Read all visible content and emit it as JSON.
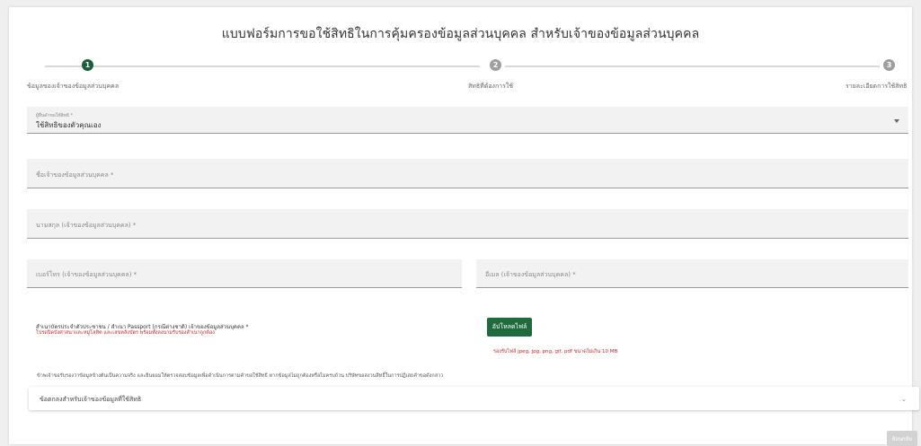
{
  "form": {
    "title": "แบบฟอร์มการขอใช้สิทธิในการคุ้มครองข้อมูลส่วนบุคคล สำหรับเจ้าของข้อมูลส่วนบุคคล"
  },
  "stepper": {
    "steps": [
      {
        "number": "1",
        "label": "ข้อมูลของเจ้าของข้อมูลส่วนบุคคล"
      },
      {
        "number": "2",
        "label": "สิทธิที่ต้องการใช้"
      },
      {
        "number": "3",
        "label": "รายละเอียดการใช้สิทธิ"
      }
    ]
  },
  "fields": {
    "requester_type": {
      "label": "ผู้ยื่นคำขอใช้สิทธิ *",
      "value": "ใช้สิทธิของตัวคุณเอง"
    },
    "full_name": {
      "label": "ชื่อเจ้าของข้อมูลส่วนบุคคล *"
    },
    "last_name": {
      "label": "นามสกุล (เจ้าของข้อมูลส่วนบุคคล) *"
    },
    "phone": {
      "label": "เบอร์โทร (เจ้าของข้อมูลส่วนบุคคล) *"
    },
    "email": {
      "label": "อีเมล (เจ้าของข้อมูลส่วนบุคคล) *"
    }
  },
  "upload": {
    "label": "สำเนาบัตรประจำตัวประชาชน / สำเนา Passport (กรณีต่างชาติ) เจ้าของข้อมูลส่วนบุคคล *",
    "hint": "โปรดปิดบังศาสนาและหมู่โลหิต และเลขหลังบัตร พร้อมทั้งลงนามรับรองสำเนาถูกต้อง",
    "button": "อัปโหลดไฟล์",
    "file_hint": "รองรับไฟล์ jpeg, jpg, png, gif, pdf ขนาดไม่เกิน 10 MB"
  },
  "consent_text": "ข้าพเจ้าขอรับรองว่าข้อมูลข้างต้นเป็นความจริง และยินยอมให้ตรวจสอบข้อมูลเพื่อดำเนินการตามคำขอใช้สิทธิ หากข้อมูลไม่ถูกต้องหรือไม่ครบถ้วน บริษัทขอสงวนสิทธิ์ในการปฏิเสธคำขอดังกล่าว",
  "consent_panel": {
    "label": "ข้อตกลงสำหรับเจ้าของข้อมูลที่ใช้สิทธิ"
  },
  "actions": {
    "back": "ย้อนกลับ"
  }
}
